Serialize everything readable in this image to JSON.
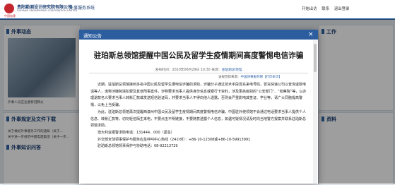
{
  "header": {
    "org_name": "贵阳勘测设计研究院有限公司",
    "org_name_en": "GUIYANG ENGINEERING CORPORATION LIMITED",
    "logo_sub": "中国电建",
    "system_name": "外事服务系统",
    "links": [
      "开始出访",
      "联系",
      "退出登录"
    ]
  },
  "left_panels": {
    "news_title": "外事动态",
    "news_caption": "外事人员应注意新冠肺炎",
    "docs_title": "外事规定及文件下载",
    "docs_items": [
      "关于做好外事服务工作的通知（关于...",
      "关于进一步规范中国电建集团（关于一步..."
    ],
    "docs_title2": "外事知识问答"
  },
  "right_panels": {
    "item1": "工作",
    "item2": "资料"
  },
  "modal": {
    "title": "通知公告",
    "close_glyph": "×",
    "article_title": "驻珀斯总领馆提醒中国公民及留学生疫情期间高度警惕电信诈骗",
    "meta_time": "发布时间：2020年06月29日 10:30 来源：",
    "meta_source": "驻珀斯总领馆",
    "source_prefix": "该规范新来源：",
    "source_link": "中国领事服务网",
    "print_link": "【打印本页】",
    "paragraphs": [
      "近期，驻珀斯总领馆接到多名中国公民及留学生遭电信诈骗的求助，诈骗分子通过技术手段冒充来电号码，冒充快递公司以查询退款电话等人，谎称涉嫌跨境犯罪及其他刑事案件，诈称要求当事人提供身份信息或银行卡资料，涉及更高级别的“公安部门”、“检察院”等，以办理退款名义要求当事人转账汇款或发送短信验证码，并要求当事人不得向他人透露，否则会严重影响其签证、学业等，请广大同胞提高警惕，以免上当受骗。",
      "为此，驻珀斯总领馆再次提醒西澳州中国公民及留学生疫情期间高度警惕电信诈骗，中国驻外使领馆不会通过电话要求当事人提供个人信息、转账汇款等，切勿轻信陌生来电，不要点击不明链接，不要随意透露个人信息，如遇可疑情况请及时向当地警方报案并联系驻珀斯总领馆求助。",
      "澳大利亚报警求助电话：131444、000（紧急）",
      "外交部全球领事保护与服务应急呼叫中心热线（24小时）：+86-10-12308或+86-10-59913991",
      "驻珀斯总领馆领事保护与协助电话：08-92213729"
    ]
  }
}
